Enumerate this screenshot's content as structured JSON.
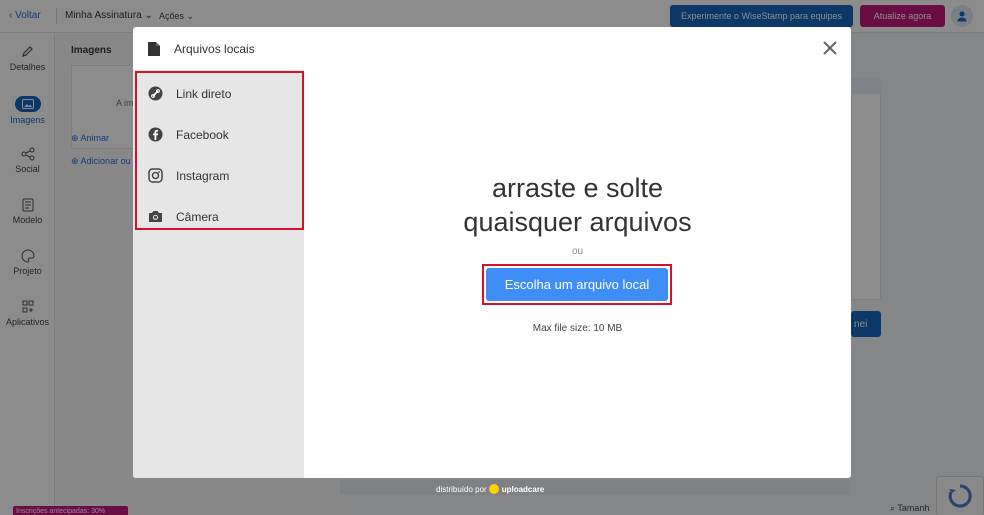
{
  "topbar": {
    "back_label": "‹ Voltar",
    "signature_name": "Minha Assinatura ⌄",
    "actions_label": "Ações ⌄",
    "teams_button": "Experimente o WiseStamp para equipes",
    "upgrade_button": "Atualize agora"
  },
  "sidebar": {
    "items": [
      {
        "label": "Detalhes",
        "icon": "pencil-icon"
      },
      {
        "label": "Imagens",
        "icon": "image-icon"
      },
      {
        "label": "Social",
        "icon": "share-icon"
      },
      {
        "label": "Modelo",
        "icon": "template-icon"
      },
      {
        "label": "Projeto",
        "icon": "palette-icon"
      },
      {
        "label": "Aplicativos",
        "icon": "apps-icon"
      }
    ]
  },
  "panel": {
    "title": "Imagens",
    "box_text": "A im",
    "animate_link": "⊕ Animar",
    "add_link": "⊕ Adicionar ou"
  },
  "background": {
    "save_button_partial": "nei",
    "promo_badge": "Inscrições antecipadas: 30%",
    "size_label": "⌕ Tamanh"
  },
  "modal": {
    "local_tab": "Arquivos locais",
    "sources": [
      {
        "label": "Link direto",
        "icon": "link-icon"
      },
      {
        "label": "Facebook",
        "icon": "facebook-icon"
      },
      {
        "label": "Instagram",
        "icon": "instagram-icon"
      },
      {
        "label": "Câmera",
        "icon": "camera-icon"
      }
    ],
    "drop_line1": "arraste e solte",
    "drop_line2": "quaisquer arquivos",
    "or_text": "ou",
    "choose_button": "Escolha um arquivo local",
    "max_size": "Max file size: 10 MB"
  },
  "footer": {
    "powered_prefix": "distribuído por",
    "powered_brand": "uploadcare"
  },
  "colors": {
    "primary": "#1565c0",
    "accent_pink": "#c2187e",
    "choose_blue": "#3f8ef5",
    "highlight_red": "#d7102c"
  }
}
